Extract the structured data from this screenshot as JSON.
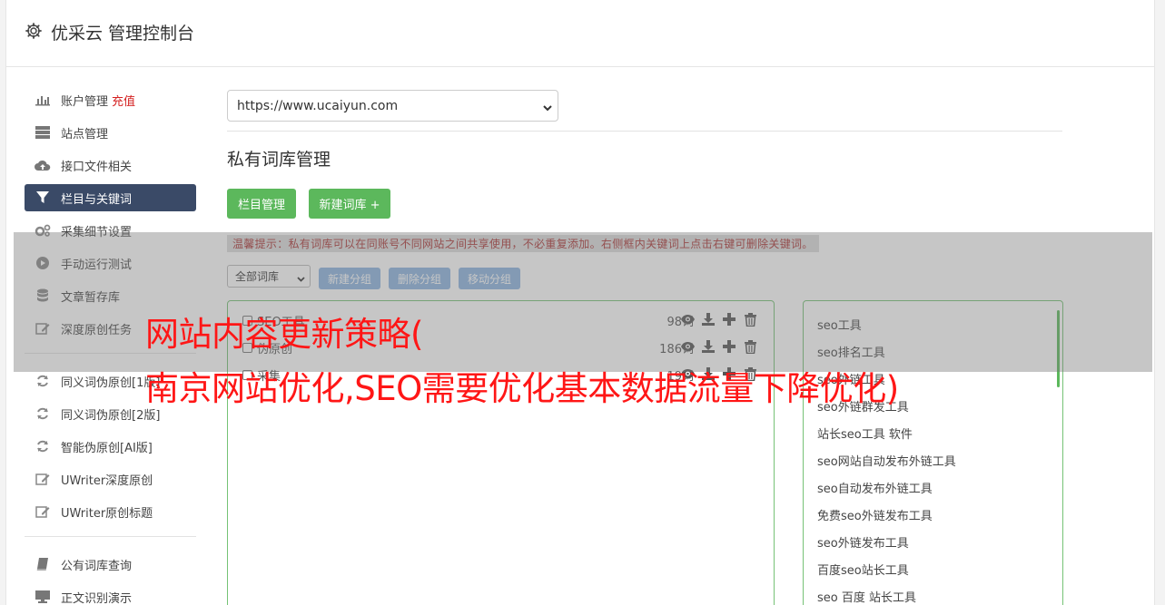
{
  "header": {
    "title": "优采云 管理控制台",
    "icon": "gear-icon"
  },
  "sidebar": {
    "group1": [
      {
        "label": "账户管理",
        "badge": "充值",
        "icon": "bar-chart-icon"
      },
      {
        "label": "站点管理",
        "icon": "server-icon"
      },
      {
        "label": "接口文件相关",
        "icon": "cloud-upload-icon"
      },
      {
        "label": "栏目与关键词",
        "icon": "filter-icon",
        "active": true
      },
      {
        "label": "采集细节设置",
        "icon": "cogs-icon"
      },
      {
        "label": "手动运行测试",
        "icon": "play-circle-icon"
      },
      {
        "label": "文章暂存库",
        "icon": "database-icon"
      },
      {
        "label": "深度原创任务",
        "icon": "edit-icon"
      }
    ],
    "group2": [
      {
        "label": "同义词伪原创[1版]",
        "icon": "refresh-icon"
      },
      {
        "label": "同义词伪原创[2版]",
        "icon": "refresh-icon"
      },
      {
        "label": "智能伪原创[AI版]",
        "icon": "refresh-icon"
      },
      {
        "label": "UWriter深度原创",
        "icon": "edit-icon"
      },
      {
        "label": "UWriter原创标题",
        "icon": "edit-icon"
      }
    ],
    "group3": [
      {
        "label": "公有词库查询",
        "icon": "book-icon"
      },
      {
        "label": "正文识别演示",
        "icon": "monitor-icon"
      }
    ]
  },
  "main": {
    "site_select": "https://www.ucaiyun.com",
    "section_title": "私有词库管理",
    "btn_column": "栏目管理",
    "btn_new_lib": "新建词库 +",
    "tip": "温馨提示：私有词库可以在同账号不同网站之间共享使用，不必重复添加。右侧框内关键词上点击右键可删除关键词。",
    "lib_filter": "全部词库",
    "btn_new_group": "新建分组",
    "btn_delete_group": "删除分组",
    "btn_move_group": "移动分组",
    "libraries": [
      {
        "name": "SEO工具",
        "count": "98词"
      },
      {
        "name": "伪原创",
        "count": "186词"
      },
      {
        "name": "采集",
        "count": "19词"
      }
    ],
    "keywords": [
      "seo工具",
      "seo排名工具",
      "seo外链工具",
      "seo外链群发工具",
      "站长seo工具 软件",
      "seo网站自动发布外链工具",
      "seo自动发布外链工具",
      "免费seo外链发布工具",
      "seo外链发布工具",
      "百度seo站长工具",
      "seo 百度 站长工具"
    ]
  },
  "overlay": {
    "line1": "网站内容更新策略(",
    "line2": "南京网站优化,SEO需要优化基本数据流量下降优化)"
  },
  "colors": {
    "active_nav": "#3a4a67",
    "green": "#5cb85c",
    "blue_btn": "#8cb4e0",
    "recharge": "#d42121",
    "overlay_text": "#ff1616"
  }
}
